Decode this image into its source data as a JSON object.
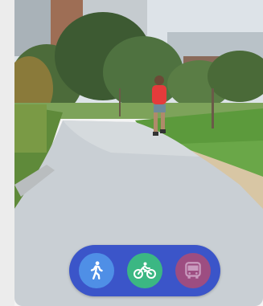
{
  "modes": [
    {
      "name": "walk",
      "icon": "walking-person-icon",
      "color": "#4f8fe6",
      "state": "available"
    },
    {
      "name": "bike",
      "icon": "bicycle-icon",
      "color": "#3bb783",
      "state": "available"
    },
    {
      "name": "transit",
      "icon": "bus-icon",
      "color": "#a84d7a",
      "state": "dimmed"
    }
  ],
  "colors": {
    "mode_bar": "#3b55c9",
    "path": "#c9cfd4",
    "grass": "#5c9a3c"
  },
  "photo": {
    "subject": "runner-on-path-photo"
  }
}
